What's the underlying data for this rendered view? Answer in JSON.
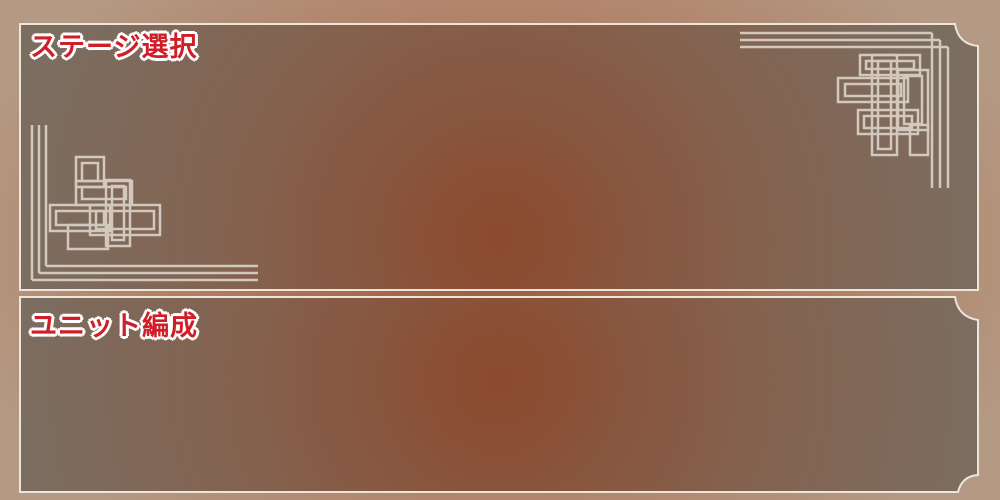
{
  "panels": {
    "stage_select": {
      "title": "ステージ選択"
    },
    "unit_formation": {
      "title": "ユニット編成"
    }
  },
  "colors": {
    "panel_fill": "#7a6c5f",
    "panel_center": "#8c4e33",
    "frame_stroke": "#e6dcd2",
    "ornament_stroke": "#d2c8be",
    "title_text": "#d01e28",
    "title_outline": "#ffffff"
  },
  "icons": {
    "top_left_ornament": "lattice-corner-ornament",
    "top_right_ornament": "lattice-corner-ornament"
  }
}
